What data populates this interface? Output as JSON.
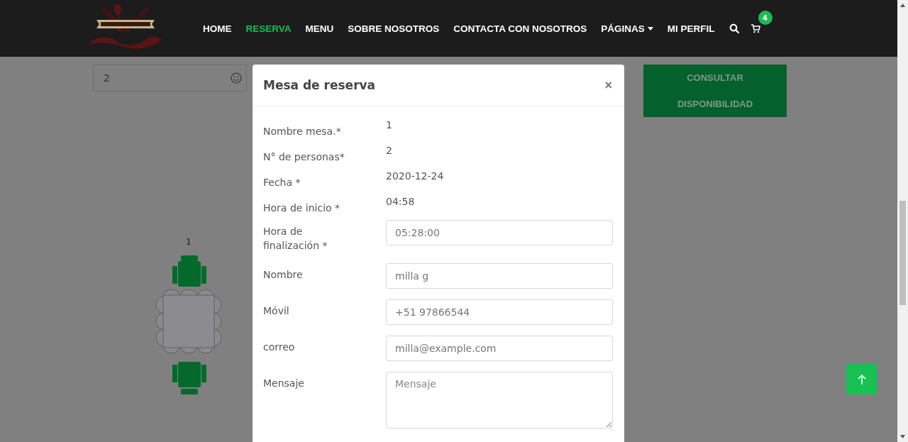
{
  "navbar": {
    "items": [
      {
        "label": "HOME",
        "selected": false,
        "kind": "link"
      },
      {
        "label": "RESERVA",
        "selected": true,
        "kind": "link"
      },
      {
        "label": "MENU",
        "selected": false,
        "kind": "link"
      },
      {
        "label": "SOBRE NOSOTROS",
        "selected": false,
        "kind": "link"
      },
      {
        "label": "CONTACTA CON NOSOTROS",
        "selected": false,
        "kind": "link"
      },
      {
        "label": "PÁGINAS",
        "selected": false,
        "kind": "dropdown"
      },
      {
        "label": "MI PERFIL",
        "selected": false,
        "kind": "link"
      }
    ],
    "cart_count": "4"
  },
  "search_form": {
    "guests": "2",
    "button": "CONSULTAR DISPONIBILIDAD"
  },
  "tables": [
    {
      "label": "1"
    }
  ],
  "modal": {
    "title": "Mesa de reserva",
    "close": "×",
    "fields": [
      {
        "label": "Nombre mesa.*",
        "kind": "text",
        "value": "1"
      },
      {
        "label": "N° de personas*",
        "kind": "text",
        "value": "2"
      },
      {
        "label": "Fecha *",
        "kind": "text",
        "value": "2020-12-24"
      },
      {
        "label": "Hora de inicio *",
        "kind": "text",
        "value": "04:58"
      },
      {
        "label": "Hora de finalización *",
        "kind": "input",
        "value": "05:28:00"
      },
      {
        "label": "Nombre",
        "kind": "input",
        "value": "milla g"
      },
      {
        "label": "Móvil",
        "kind": "input",
        "value": "+51 97866544"
      },
      {
        "label": "correo",
        "kind": "input",
        "value": "milla@example.com"
      },
      {
        "label": "Mensaje",
        "kind": "textarea",
        "placeholder": "Mensaje"
      }
    ]
  }
}
